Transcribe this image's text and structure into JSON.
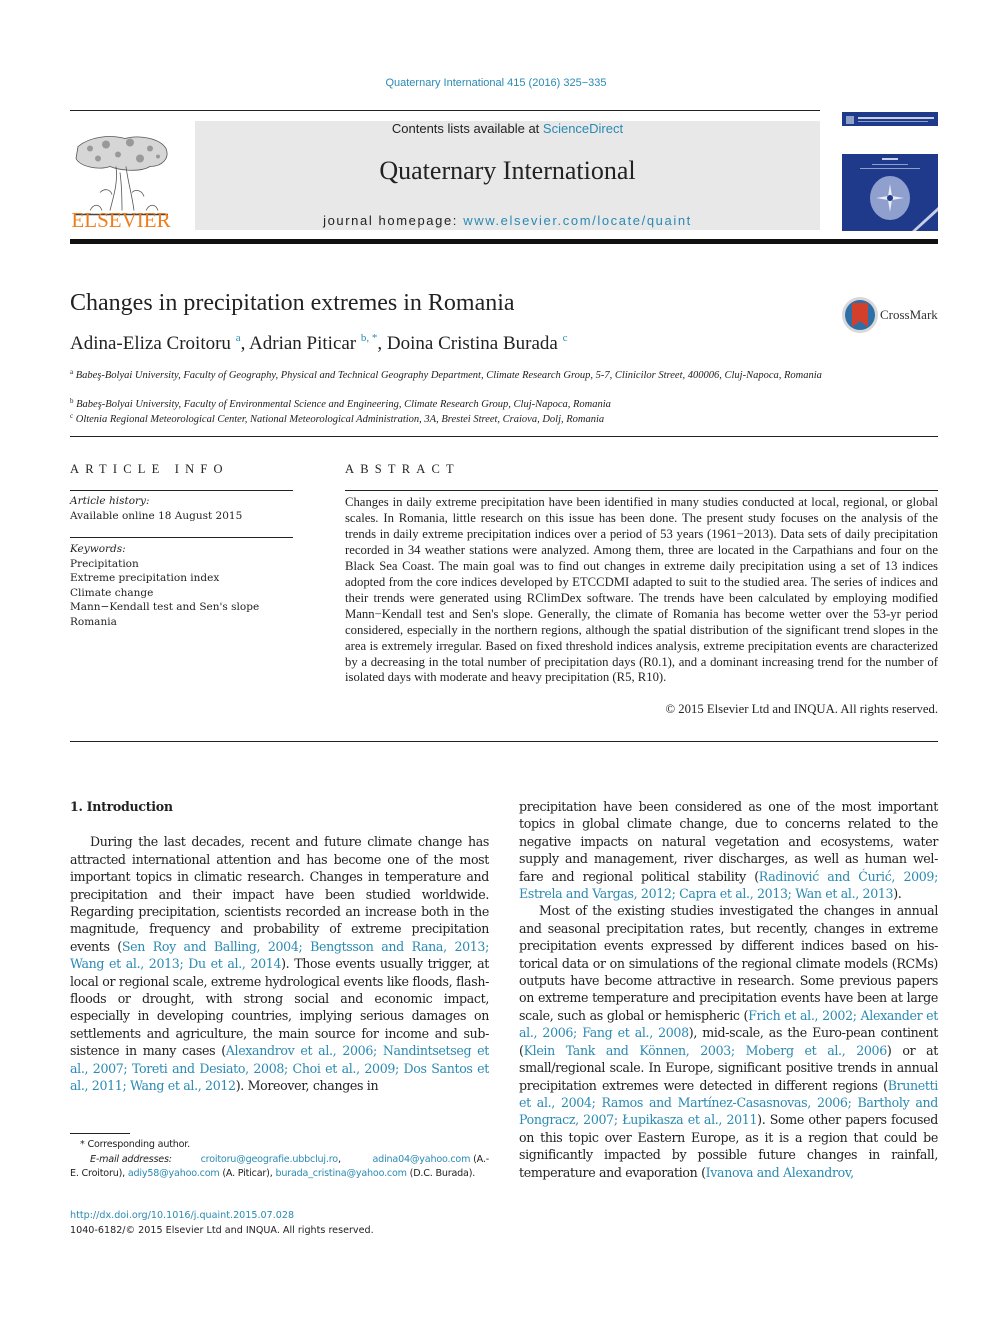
{
  "header": {
    "journal_ref": "Quaternary International 415 (2016) 325−335",
    "contents_prefix": "Contents lists available at ",
    "contents_link": "ScienceDirect",
    "journal_name": "Quaternary International",
    "homepage_prefix": "journal homepage: ",
    "homepage_link": "www.elsevier.com/locate/quaint",
    "publisher_logo_text": "ELSEVIER",
    "crossmark_label": "CrossMark"
  },
  "colors": {
    "link": "#2a8ab3",
    "elsevier_orange": "#f07d1a",
    "cover_blue": "#1f3a8a",
    "masthead_gray": "#e8e8e8"
  },
  "article": {
    "title": "Changes in precipitation extremes in Romania",
    "authors": [
      {
        "name": "Adina-Eliza Croitoru",
        "sup": "a"
      },
      {
        "name": "Adrian Piticar",
        "sup": "b, *"
      },
      {
        "name": "Doina Cristina Burada",
        "sup": "c"
      }
    ],
    "affiliations": [
      {
        "mark": "a",
        "text": "Babeş-Bolyai University, Faculty of Geography, Physical and Technical Geography Department, Climate Research Group, 5-7, Clinicilor Street, 400006, Cluj-Napoca, Romania"
      },
      {
        "mark": "b",
        "text": "Babeş-Bolyai University, Faculty of Environmental Science and Engineering, Climate Research Group, Cluj-Napoca, Romania"
      },
      {
        "mark": "c",
        "text": "Oltenia Regional Meteorological Center, National Meteorological Administration, 3A, Brestei Street, Craiova, Dolj, Romania"
      }
    ]
  },
  "article_info": {
    "heading": "ARTICLE INFO",
    "history_label": "Article history:",
    "history_value": "Available online 18 August 2015",
    "keywords_label": "Keywords:",
    "keywords": [
      "Precipitation",
      "Extreme precipitation index",
      "Climate change",
      "Mann−Kendall test and Sen's slope",
      "Romania"
    ]
  },
  "abstract": {
    "heading": "ABSTRACT",
    "text": "Changes in daily extreme precipitation have been identified in many studies conducted at local, regional, or global scales. In Romania, little research on this issue has been done. The present study focuses on the analysis of the trends in daily extreme precipitation indices over a period of 53 years (1961−2013). Data sets of daily precipitation recorded in 34 weather stations were analyzed. Among them, three are located in the Carpathians and four on the Black Sea Coast. The main goal was to find out changes in extreme daily precipitation using a set of 13 indices adopted from the core indices developed by ETCCDMI adapted to suit to the studied area. The series of indices and their trends were generated using RClimDex software. The trends have been calculated by employing modified Mann−Kendall test and Sen's slope. Generally, the climate of Romania has become wetter over the 53-yr period considered, especially in the northern regions, although the spatial distribution of the significant trend slopes in the area is extremely irregular. Based on fixed threshold indices analysis, extreme precipitation events are characterized by a decreasing in the total number of precipitation days (R0.1), and a dominant increasing trend for the number of isolated days with moderate and heavy precipitation (R5, R10).",
    "copyright": "© 2015 Elsevier Ltd and INQUA. All rights reserved."
  },
  "body": {
    "section_heading": "1.  Introduction",
    "left_para": [
      {
        "t": "During the last decades, recent and future climate change has attracted international attention and has become one of the most important topics in climatic research. Changes in temperature and precipitation and their impact have been studied worldwide. Regarding precipitation, scientists recorded an increase both in the magnitude, frequency and probability of extreme precipitation events ("
      },
      {
        "c": "Sen Roy and Balling, 2004; Bengtsson and Rana, 2013; Wang et al., 2013; Du et al., 2014"
      },
      {
        "t": "). Those events usually trigger, at local or regional scale, extreme hydrological events like floods, flash-floods or drought, with strong social and economic impact, especially in developing countries, implying serious damages on settlements and agriculture, the main source for income and sub-sistence in many cases ("
      },
      {
        "c": "Alexandrov et al., 2006; Nandintsetseg et al., 2007; Toreti and Desiato, 2008; Choi et al., 2009; Dos Santos et al., 2011; Wang et al., 2012"
      },
      {
        "t": "). Moreover, changes in"
      }
    ],
    "right_para1": [
      {
        "t": "precipitation have been considered as one of the most important topics in global climate change, due to concerns related to the negative impacts on natural vegetation and ecosystems, water supply and management, river discharges, as well as human wel-fare and regional political stability ("
      },
      {
        "c": "Radinović and Ćurić, 2009; Estrela and Vargas, 2012; Capra et al., 2013; Wan et al., 2013"
      },
      {
        "t": ")."
      }
    ],
    "right_para2": [
      {
        "t": "Most of the existing studies investigated the changes in annual and seasonal precipitation rates, but recently, changes in extreme precipitation events expressed by different indices based on his-torical data or on simulations of the regional climate models (RCMs) outputs have become attractive in research. Some previous papers on extreme temperature and precipitation events have been at large scale, such as global or hemispheric ("
      },
      {
        "c": "Frich et al., 2002; Alexander et al., 2006; Fang et al., 2008"
      },
      {
        "t": "), mid-scale, as the Euro-pean continent ("
      },
      {
        "c": "Klein Tank and Können, 2003; Moberg et al., 2006"
      },
      {
        "t": ") or at small/regional scale. In Europe, significant positive trends in annual precipitation extremes were detected in different regions ("
      },
      {
        "c": "Brunetti et al., 2004; Ramos and Martínez-Casasnovas, 2006; Bartholy and Pongracz, 2007; Łupikasza et al., 2011"
      },
      {
        "t": "). Some other papers focused on this topic over Eastern Europe, as it is a region that could be significantly impacted by possible future changes in rainfall, temperature and evaporation ("
      },
      {
        "c": "Ivanova and Alexandrov,"
      }
    ]
  },
  "footnote": {
    "corresponding": "* Corresponding author.",
    "email_label": "E-mail addresses:",
    "emails": [
      {
        "addr": "croitoru@geografie.ubbcluj.ro",
        "who": ""
      },
      {
        "addr": "adina04@yahoo.com",
        "who": "(A.-E. Croitoru),"
      },
      {
        "addr": "adiy58@yahoo.com",
        "who": "(A. Piticar),"
      },
      {
        "addr": "burada_cristina@yahoo.com",
        "who": "(D.C. Burada)."
      }
    ],
    "doi": "http://dx.doi.org/10.1016/j.quaint.2015.07.028",
    "issn": "1040-6182/© 2015 Elsevier Ltd and INQUA. All rights reserved."
  }
}
